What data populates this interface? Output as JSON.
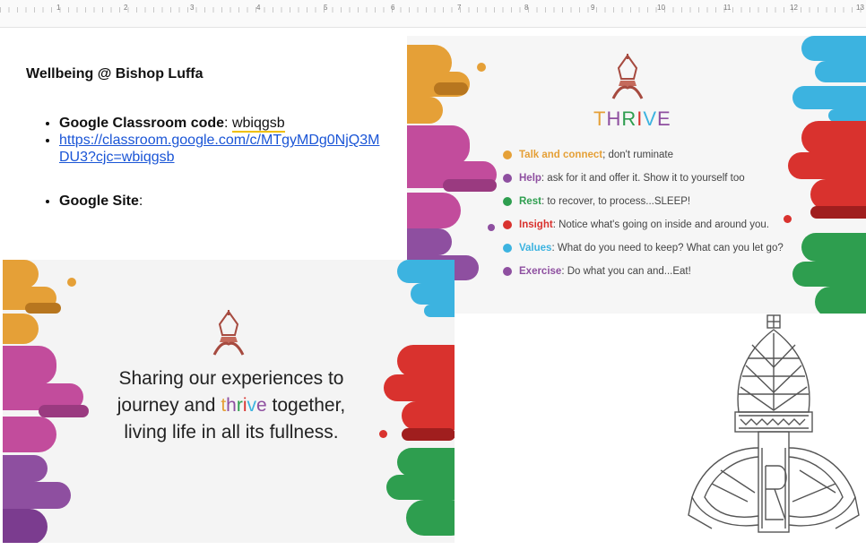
{
  "ruler": {
    "numbers": [
      "1",
      "2",
      "3",
      "4",
      "5",
      "6",
      "7",
      "8",
      "9",
      "10",
      "11",
      "12",
      "13"
    ]
  },
  "doc": {
    "title": "Wellbeing @ Bishop Luffa",
    "classroom_label": "Google Classroom code",
    "classroom_sep": ": ",
    "classroom_code": "wbiqgsb",
    "classroom_link": "https://classroom.google.com/c/MTgyMDg0NjQ3MDU3?cjc=wbiqgsb",
    "site_label": "Google Site",
    "site_sep": ":"
  },
  "thrive_slide": {
    "title_letters": [
      {
        "ch": "T",
        "color": "#e5a037"
      },
      {
        "ch": "H",
        "color": "#8e4fa0"
      },
      {
        "ch": "R",
        "color": "#2e9e4f"
      },
      {
        "ch": "I",
        "color": "#d9322e"
      },
      {
        "ch": "V",
        "color": "#3cb3e0"
      },
      {
        "ch": "E",
        "color": "#8e4fa0"
      }
    ],
    "items": [
      {
        "key": "Talk and connect",
        "rest": "; don't ruminate",
        "color": "#e5a037"
      },
      {
        "key": "Help",
        "rest": ": ask for it and offer it. Show it to yourself too",
        "color": "#8e4fa0"
      },
      {
        "key": "Rest",
        "rest": ": to recover, to process...SLEEP!",
        "color": "#2e9e4f"
      },
      {
        "key": "Insight",
        "rest": ": Notice what's going on inside and around you.",
        "color": "#d9322e"
      },
      {
        "key": "Values",
        "rest": ": What do you need to keep? What can you let go?",
        "color": "#3cb3e0"
      },
      {
        "key": "Exercise",
        "rest": ": Do what you can and...Eat!",
        "color": "#8e4fa0"
      }
    ]
  },
  "sharing_slide": {
    "line1": "Sharing our experiences to",
    "line2_pre": "journey and ",
    "thrive_word": [
      {
        "ch": "t",
        "color": "#e5a037"
      },
      {
        "ch": "h",
        "color": "#8e4fa0"
      },
      {
        "ch": "r",
        "color": "#2e9e4f"
      },
      {
        "ch": "i",
        "color": "#d9322e"
      },
      {
        "ch": "v",
        "color": "#3cb3e0"
      },
      {
        "ch": "e",
        "color": "#8e4fa0"
      }
    ],
    "line2_post": " together,",
    "line3": "living life in all its fullness."
  },
  "colors": {
    "orange": "#e5a037",
    "purple": "#8e4fa0",
    "pink": "#c24c9c",
    "green": "#2e9e4f",
    "red": "#d9322e",
    "blue": "#3cb3e0",
    "link": "#1a55d6"
  },
  "icons": {
    "logo": "bishop-mitre-logo-icon",
    "drawing": "bishop-mitre-drawing-icon"
  }
}
